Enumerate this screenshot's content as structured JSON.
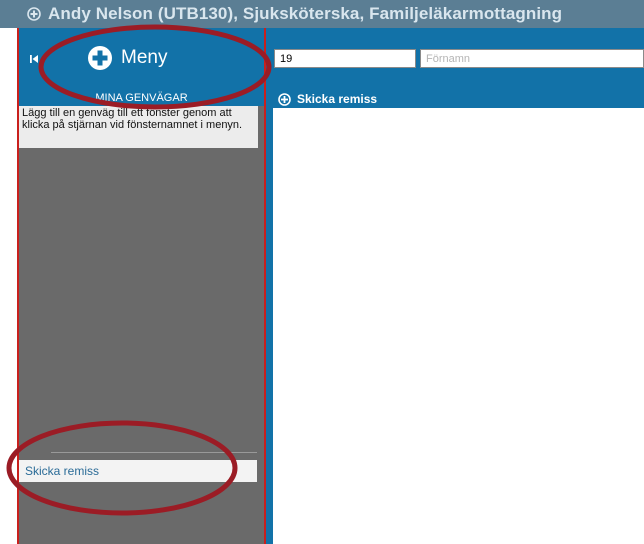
{
  "window": {
    "title": "Andy Nelson (UTB130), Sjuksköterska, Familjeläkarmottagning"
  },
  "menu": {
    "label": "Meny"
  },
  "search": {
    "personnummer_value": "19",
    "fornamn_placeholder": "Förnamn"
  },
  "shortcuts": {
    "title": "MINA GENVÄGAR",
    "hint": "Lägg till en genväg till ett fönster genom att klicka på stjärnan vid fönsternamnet i menyn.",
    "items": [
      {
        "label": "Skicka remiss"
      }
    ]
  },
  "content": {
    "title": "Skicka remiss"
  },
  "colors": {
    "accent": "#1272a8",
    "titlebar": "#5b7e94",
    "panel": "#6a6a6a",
    "annotation": "#9b1c25"
  },
  "icons": {
    "title_icon": "plus-circle-icon",
    "collapse_icon": "collapse-left-icon",
    "menu_icon": "plus-circle-icon",
    "content_icon": "plus-circle-icon"
  }
}
